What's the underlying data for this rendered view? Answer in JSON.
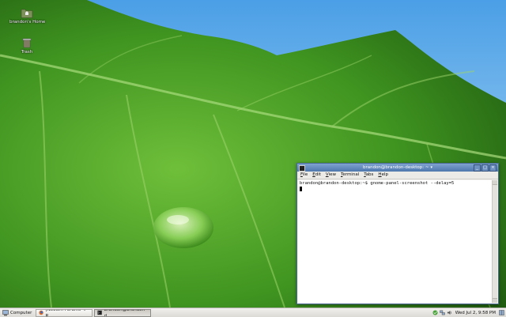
{
  "desktop": {
    "icons": [
      {
        "label": "brandon's Home",
        "icon": "home-folder-icon"
      },
      {
        "label": "Trash",
        "icon": "trash-icon"
      }
    ]
  },
  "terminal": {
    "title": "brandon@brandon-desktop: ~",
    "menu": [
      "File",
      "Edit",
      "View",
      "Terminal",
      "Tabs",
      "Help"
    ],
    "prompt": "brandon@brandon-desktop:~$ gnome-panel-screenshot --delay=5"
  },
  "panel": {
    "computer_label": "Computer",
    "tasks": [
      {
        "label": "[Neowin Forums -> R...",
        "icon": "firefox-icon"
      },
      {
        "label": "brandon@brandon-d...",
        "icon": "terminal-icon"
      }
    ],
    "clock": "Wed Jul  2,  9:58 PM"
  }
}
